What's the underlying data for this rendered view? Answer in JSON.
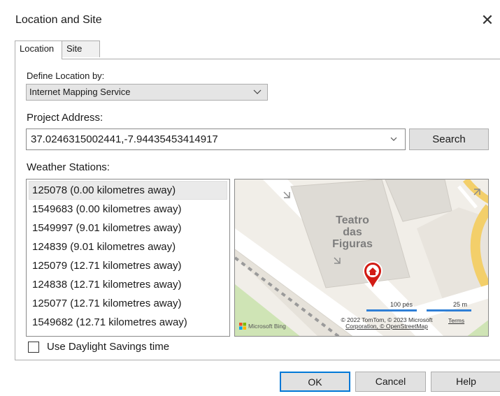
{
  "window": {
    "title": "Location and Site",
    "close_glyph": "✕"
  },
  "tabs": [
    {
      "label": "Location"
    },
    {
      "label": "Site"
    }
  ],
  "location": {
    "define_label": "Define Location by:",
    "define_value": "Internet Mapping Service",
    "address_label": "Project Address:",
    "address_value": "37.0246315002441,-7.94435453414917",
    "search_label": "Search",
    "weather_label": "Weather Stations:",
    "stations": [
      "125078 (0.00 kilometres away)",
      "1549683 (0.00 kilometres away)",
      "1549997 (9.01 kilometres away)",
      "124839 (9.01 kilometres away)",
      "125079 (12.71 kilometres away)",
      "124838 (12.71 kilometres away)",
      "125077 (12.71 kilometres away)",
      "1549682 (12.71 kilometres away)"
    ],
    "daylight_label": "Use Daylight Savings time"
  },
  "map": {
    "place_line1": "Teatro",
    "place_line2": "das",
    "place_line3": "Figuras",
    "scale_left": "100 pés",
    "scale_right": "25 m",
    "copyright_line1": "© 2022 TomTom, © 2023 Microsoft",
    "copyright_line2": "Corporation, © OpenStreetMap",
    "terms": "Terms",
    "brand": "Microsoft Bing",
    "pin_icon": "home-pin-icon"
  },
  "footer": {
    "ok": "OK",
    "cancel": "Cancel",
    "help": "Help"
  },
  "colors": {
    "ok_border": "#0078d7",
    "pin": "#d21b14",
    "road_yellow": "#f7d96b",
    "scale": "#2f7fd6"
  }
}
